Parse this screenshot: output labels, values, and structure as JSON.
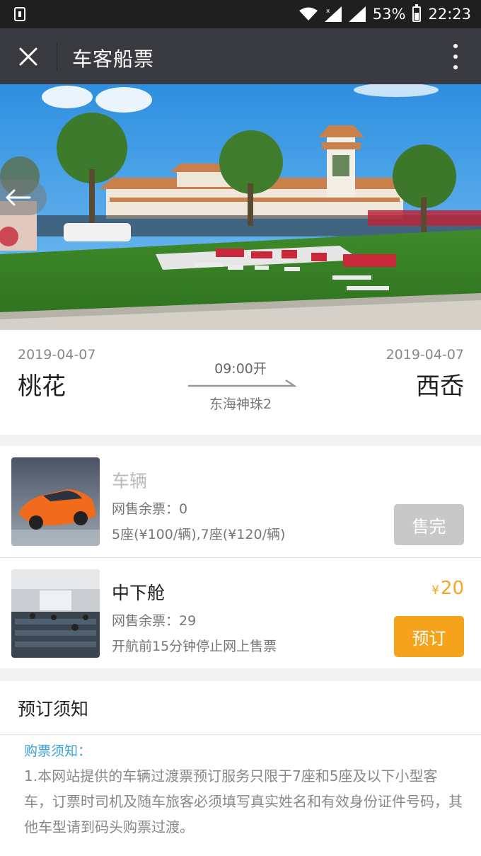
{
  "status_bar": {
    "battery": "53%",
    "battery_level": 0.53,
    "time": "22:23"
  },
  "titlebar": {
    "title": "车客船票",
    "close_icon": "close-icon",
    "more_icon": "more-vertical-icon"
  },
  "hero": {
    "back_icon": "arrow-left-icon"
  },
  "route": {
    "depart_date": "2019-04-07",
    "depart_city": "桃花",
    "arrive_date": "2019-04-07",
    "arrive_city": "西岙",
    "depart_time": "09:00开",
    "ship": "东海神珠2"
  },
  "tickets": [
    {
      "name": "车辆",
      "remain": "网售余票：0",
      "note": "5座(¥100/辆),7座(¥120/辆)",
      "button": "售完"
    },
    {
      "name": "中下舱",
      "remain": "网售余票：29",
      "note": "开航前15分钟停止网上售票",
      "price_symbol": "¥",
      "price": "20",
      "button": "预订"
    }
  ],
  "notice": {
    "title": "预订须知",
    "subtitle": "购票须知：",
    "body": "1.本网站提供的车辆过渡票预订服务只限于7座和5座及以下小型客车，订票时司机及随车旅客必须填写真实姓名和有效身份证件号码，其他车型请到码头购票过渡。"
  },
  "colors": {
    "titlebar_bg": "#393a3f",
    "accent_orange": "#f5a31a",
    "soldout_gray": "#c8c8c8",
    "link_blue": "#3a9fd8"
  }
}
